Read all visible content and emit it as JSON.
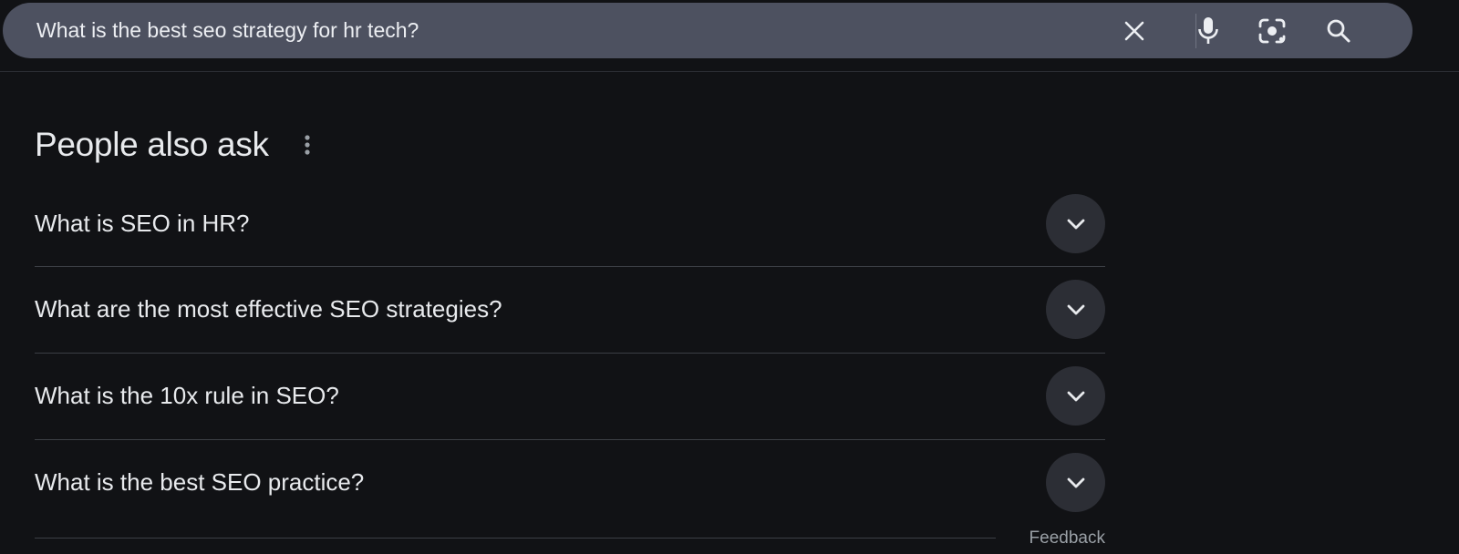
{
  "search": {
    "query": "What is the best seo strategy for hr tech?",
    "icons": [
      "close-icon",
      "microphone-icon",
      "lens-camera-icon",
      "search-icon"
    ]
  },
  "paa": {
    "title": "People also ask",
    "menu_icon": "more-vert-icon",
    "questions": [
      "What is SEO in HR?",
      "What are the most effective SEO strategies?",
      "What is the 10x rule in SEO?",
      "What is the best SEO practice?"
    ],
    "expand_icon": "chevron-down-icon",
    "feedback_label": "Feedback"
  }
}
